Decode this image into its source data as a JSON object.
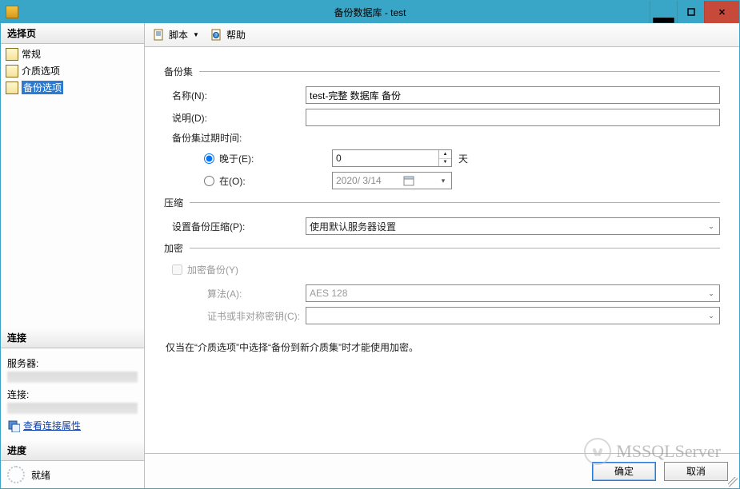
{
  "titlebar": {
    "title": "备份数据库 - test"
  },
  "sidebar": {
    "select_page": "选择页",
    "items": [
      {
        "label": "常规"
      },
      {
        "label": "介质选项"
      },
      {
        "label": "备份选项"
      }
    ],
    "connection_header": "连接",
    "server_label": "服务器:",
    "conn_label": "连接:",
    "view_props_link": "查看连接属性",
    "progress_header": "进度",
    "progress_status": "就绪"
  },
  "toolbar": {
    "script_label": "脚本",
    "help_label": "帮助"
  },
  "groups": {
    "backup_set": "备份集",
    "compression": "压缩",
    "encryption": "加密"
  },
  "fields": {
    "name_label": "名称(N):",
    "name_value": "test-完整 数据库 备份",
    "desc_label": "说明(D):",
    "desc_value": "",
    "expire_label": "备份集过期时间:",
    "after_label": "晚于(E):",
    "after_value": "0",
    "after_unit": "天",
    "on_label": "在(O):",
    "on_value": "2020/ 3/14",
    "compression_label": "设置备份压缩(P):",
    "compression_value": "使用默认服务器设置",
    "encrypt_checkbox": "加密备份(Y)",
    "algorithm_label": "算法(A):",
    "algorithm_value": "AES 128",
    "cert_label": "证书或非对称密钥(C):",
    "cert_value": ""
  },
  "note": "仅当在“介质选项”中选择“备份到新介质集”时才能使用加密。",
  "buttons": {
    "ok": "确定",
    "cancel": "取消"
  },
  "watermark": "MSSQLServer"
}
